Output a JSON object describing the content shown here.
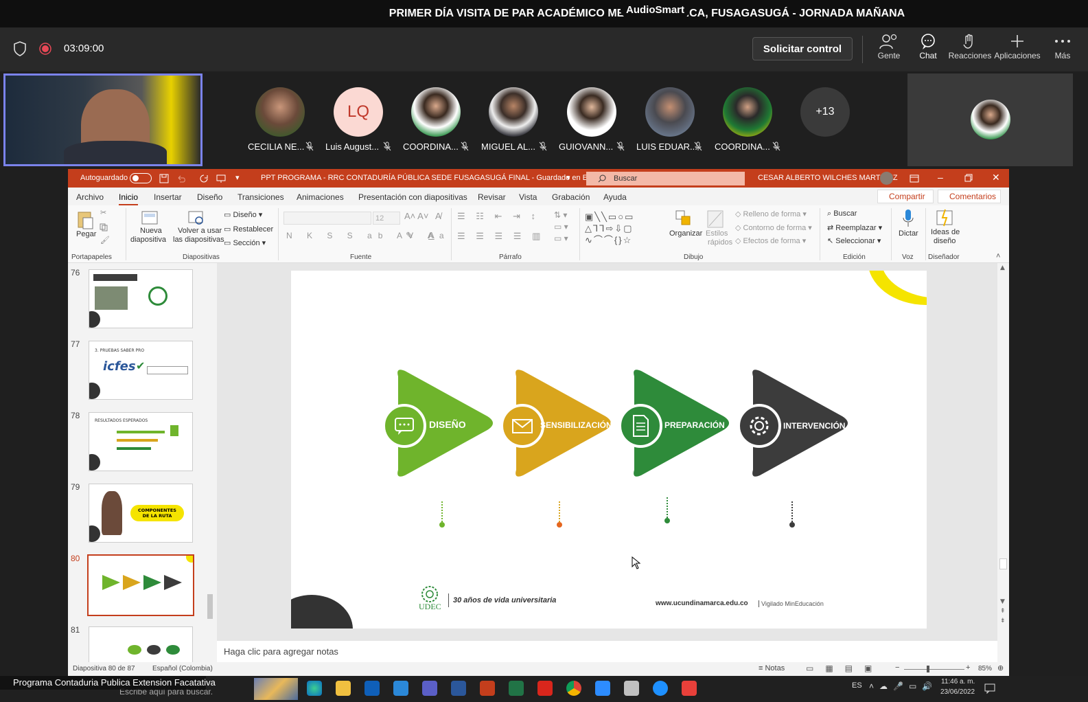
{
  "meeting": {
    "title": "PRIMER DÍA VISITA DE PAR ACADÉMICO MEN R                A PÚBLICA, FUSAGASUGÁ - JORNADA MAÑANA",
    "overlay": "AudioSmart",
    "timer": "03:09:00",
    "request_control": "Solicitar control",
    "toolbar": [
      {
        "label": "Gente",
        "icon": "people-icon"
      },
      {
        "label": "Chat",
        "icon": "chat-icon"
      },
      {
        "label": "Reacciones",
        "icon": "reactions-icon"
      },
      {
        "label": "Aplicaciones",
        "icon": "plus-icon"
      },
      {
        "label": "Más",
        "icon": "more-icon"
      }
    ],
    "participants": [
      {
        "name": "CECILIA NE...",
        "initials": ""
      },
      {
        "name": "Luis August...",
        "initials": "LQ"
      },
      {
        "name": "COORDINA...",
        "initials": ""
      },
      {
        "name": "MIGUEL AL...",
        "initials": ""
      },
      {
        "name": "GUIOVANN...",
        "initials": ""
      },
      {
        "name": "LUIS EDUAR...",
        "initials": ""
      },
      {
        "name": "COORDINA...",
        "initials": ""
      }
    ],
    "more_count": "+13",
    "caption": "Programa Contaduria Publica Extension Facatativa"
  },
  "ppt": {
    "autosave": "Autoguardado",
    "doc_title": "PPT PROGRAMA - RRC CONTADURÍA PÚBLICA SEDE FUSAGASUGÁ FINAL  -  Guardado en Este PC",
    "search": "Buscar",
    "user": "CESAR ALBERTO WILCHES MARTINEZ",
    "menu": [
      "Archivo",
      "Inicio",
      "Insertar",
      "Diseño",
      "Transiciones",
      "Animaciones",
      "Presentación con diapositivas",
      "Revisar",
      "Vista",
      "Grabación",
      "Ayuda"
    ],
    "share": "Compartir",
    "comments": "Comentarios",
    "ribbon": {
      "paste": "Pegar",
      "new_slide_1": "Nueva",
      "new_slide_2": "diapositiva",
      "reuse_1": "Volver a usar",
      "reuse_2": "las diapositivas",
      "layout": "Diseño",
      "reset": "Restablecer",
      "section": "Sección",
      "font_size": "12",
      "arrange": "Organizar",
      "quick_styles_1": "Estilos",
      "quick_styles_2": "rápidos",
      "fill": "Relleno de forma",
      "outline": "Contorno de forma",
      "effects": "Efectos de forma",
      "find": "Buscar",
      "replace": "Reemplazar",
      "select": "Seleccionar",
      "dictate": "Dictar",
      "ideas_1": "Ideas de",
      "ideas_2": "diseño",
      "groups": [
        "Portapapeles",
        "Diapositivas",
        "Fuente",
        "Párrafo",
        "Dibujo",
        "Edición",
        "Voz",
        "Diseñador"
      ]
    },
    "thumbnails": [
      "76",
      "77",
      "78",
      "79",
      "80",
      "81"
    ],
    "thumb_texts": {
      "t77_heading": "3. PRUEBAS SABER PRO",
      "t77_logo": "icfes",
      "t78_heading": "RESULTADOS ESPERADOS",
      "t79_label_1": "COMPONENTES",
      "t79_label_2": "DE LA RUTA"
    },
    "slide": {
      "steps": [
        {
          "label": "DISEÑO",
          "color": "#6fb42c",
          "icon": "chat-bubble-icon"
        },
        {
          "label": "SENSIBILIZACIÓN",
          "color": "#d9a51d",
          "icon": "envelope-icon"
        },
        {
          "label": "PREPARACIÓN",
          "color": "#2e8b3a",
          "icon": "document-icon"
        },
        {
          "label": "INTERVENCIÓN",
          "color": "#3c3c3c",
          "icon": "gear-icon"
        }
      ],
      "footer_logo": "UDEC",
      "footer_tagline": "30 años de vida universitaria",
      "footer_url": "www.ucundinamarca.edu.co",
      "footer_vigilado": "Vigilado MinEducación"
    },
    "notes": "Haga clic para agregar notas",
    "status": {
      "slide_counter": "Diapositiva 80 de 87",
      "language": "Español (Colombia)",
      "notes_btn": "Notas",
      "zoom": "85%"
    }
  },
  "taskbar": {
    "search": "Escribe aquí para buscar.",
    "lang": "ES",
    "time": "11:46 a. m.",
    "date": "23/06/2022"
  }
}
